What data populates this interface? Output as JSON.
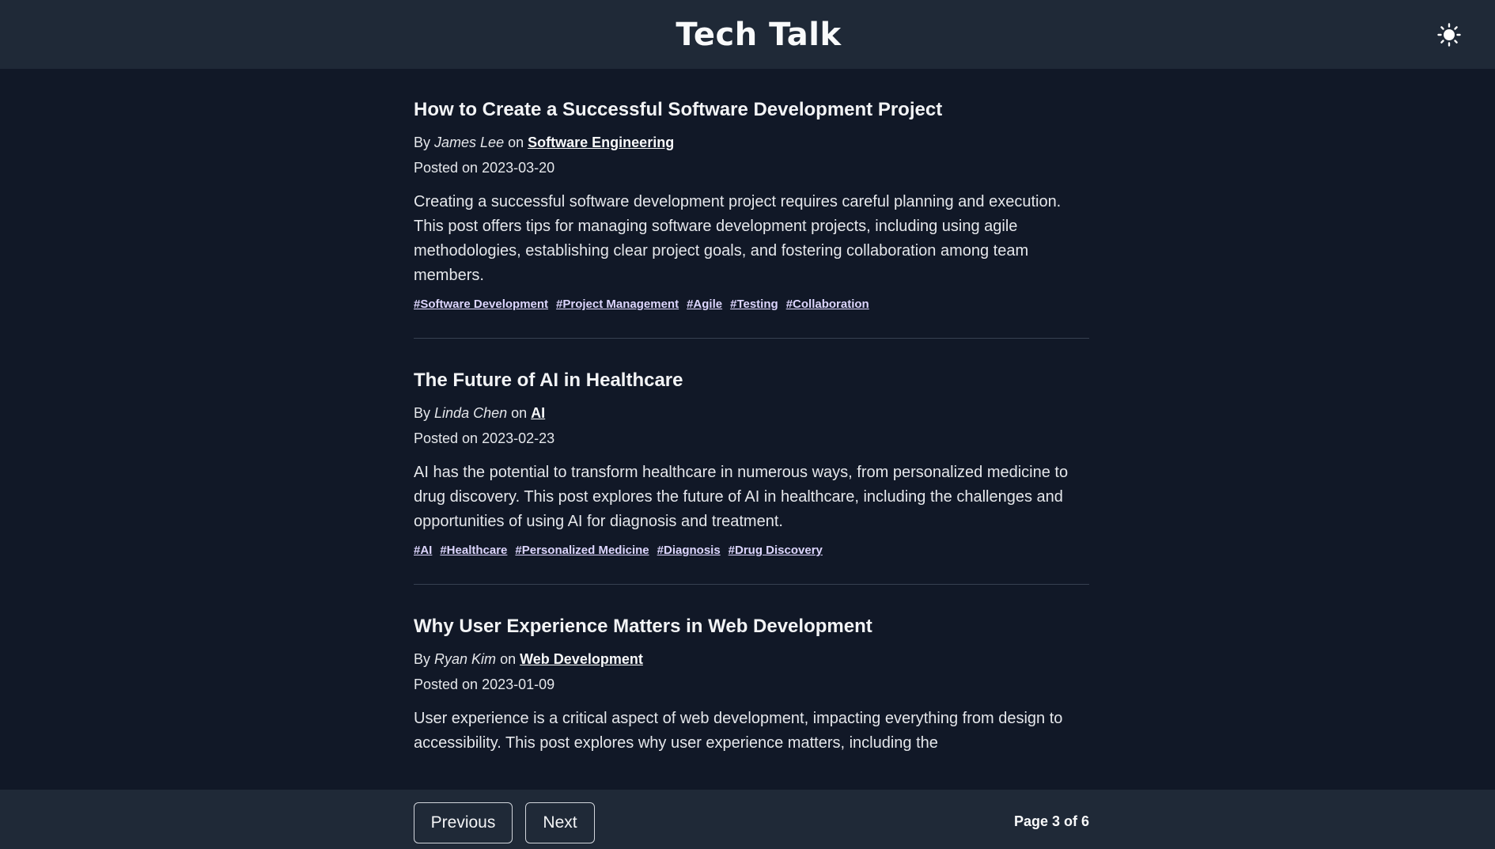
{
  "header": {
    "title": "Tech Talk",
    "theme_toggle_icon": "sun-icon"
  },
  "labels": {
    "by": "By",
    "on": "on",
    "posted_on": "Posted on"
  },
  "posts": [
    {
      "title": "How to Create a Successful Software Development Project",
      "author": "James Lee",
      "category": "Software Engineering",
      "date": "2023-03-20",
      "body": "Creating a successful software development project requires careful planning and execution. This post offers tips for managing software development projects, including using agile methodologies, establishing clear project goals, and fostering collaboration among team members.",
      "tags": [
        "#Software Development",
        "#Project Management",
        "#Agile",
        "#Testing",
        "#Collaboration"
      ]
    },
    {
      "title": "The Future of AI in Healthcare",
      "author": "Linda Chen",
      "category": "AI",
      "date": "2023-02-23",
      "body": "AI has the potential to transform healthcare in numerous ways, from personalized medicine to drug discovery. This post explores the future of AI in healthcare, including the challenges and opportunities of using AI for diagnosis and treatment.",
      "tags": [
        "#AI",
        "#Healthcare",
        "#Personalized Medicine",
        "#Diagnosis",
        "#Drug Discovery"
      ]
    },
    {
      "title": "Why User Experience Matters in Web Development",
      "author": "Ryan Kim",
      "category": "Web Development",
      "date": "2023-01-09",
      "body": "User experience is a critical aspect of web development, impacting everything from design to accessibility. This post explores why user experience matters, including the",
      "tags": []
    }
  ],
  "pagination": {
    "previous_label": "Previous",
    "next_label": "Next",
    "page_info": "Page 3 of 6"
  },
  "colors": {
    "page_background": "#111827",
    "header_background": "#1f2937",
    "tag_color": "#ddd6fe"
  }
}
